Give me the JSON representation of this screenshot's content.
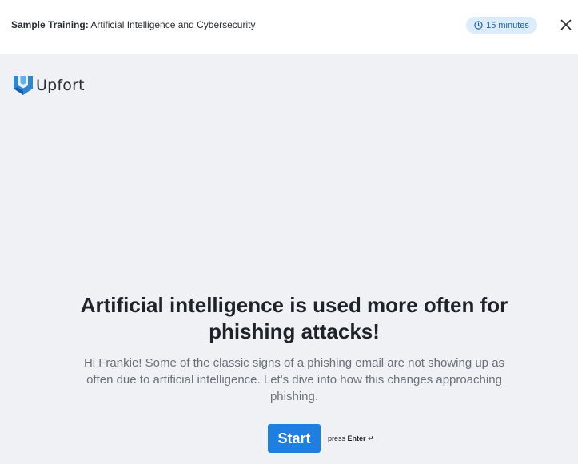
{
  "header": {
    "course_prefix": "Sample Training:",
    "course_name": "Artificial Intelligence and Cybersecurity",
    "duration": "15 minutes",
    "duration_icon": "clock-icon",
    "close_icon": "close-icon"
  },
  "logo": {
    "text": "Upfort",
    "icon": "upfort-logo-icon"
  },
  "main": {
    "headline": "Artificial intelligence is used more often for phishing attacks!",
    "intro": "Hi Frankie! Some of the classic signs of a phishing email are not showing up as often due to artificial intelligence. Let's dive into how this changes approaching phishing.",
    "start_label": "Start",
    "hint_press": "press",
    "hint_key": "Enter ↵"
  },
  "colors": {
    "accent": "#1f7fe0",
    "badge_bg": "#dcecfb",
    "badge_text": "#1a5fae",
    "logo_blue": "#2f86d6",
    "page_bg": "#f0f1f4"
  }
}
